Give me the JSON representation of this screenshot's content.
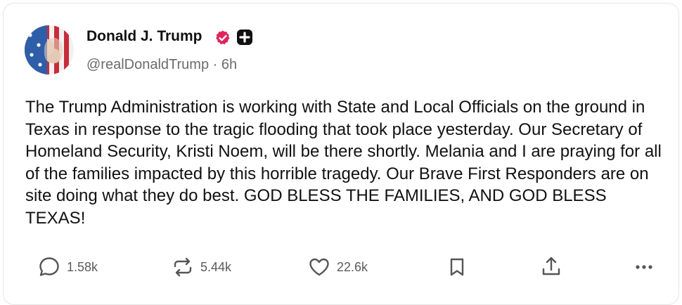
{
  "post": {
    "author_name": "Donald J. Trump",
    "handle": "@realDonaldTrump",
    "separator": " · ",
    "time": "6h",
    "text": "The Trump Administration is working with State and Local Officials on the ground in Texas in response to the tragic flooding that took place yesterday. Our Secretary of Homeland Security, Kristi Noem, will be there shortly. Melania and I are praying for all of the families impacted by this horrible tragedy. Our Brave First Responders are on site doing what they do best. GOD BLESS THE FAMILIES, AND GOD BLESS TEXAS!"
  },
  "badges": {
    "verified_icon": "verified-check-icon",
    "plus_icon": "plus-icon",
    "verified_color": "#e0245e"
  },
  "actions": {
    "replies": {
      "icon": "comment-icon",
      "count": "1.58k"
    },
    "reposts": {
      "icon": "repost-icon",
      "count": "5.44k"
    },
    "likes": {
      "icon": "heart-icon",
      "count": "22.6k"
    },
    "bookmark": {
      "icon": "bookmark-icon"
    },
    "share": {
      "icon": "share-icon"
    },
    "more": {
      "icon": "more-icon"
    }
  }
}
